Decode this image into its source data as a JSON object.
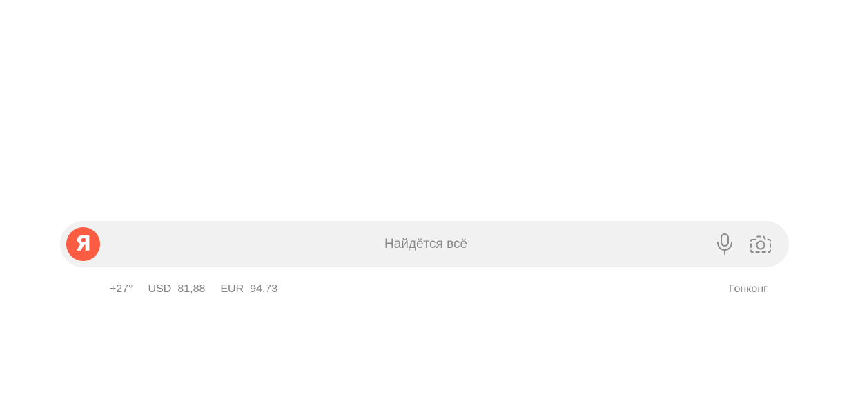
{
  "search": {
    "logo_letter": "Я",
    "placeholder": "Найдётся всё",
    "mic_icon": "microphone-icon",
    "camera_icon": "camera-icon"
  },
  "informers": {
    "weather": "+27°",
    "usd_label": "USD",
    "usd_value": "81,88",
    "eur_label": "EUR",
    "eur_value": "94,73",
    "region": "Гонконг"
  },
  "colors": {
    "logo_bg": "#fc5d42",
    "search_bg": "#f1f1f1",
    "muted_text": "#828282"
  }
}
